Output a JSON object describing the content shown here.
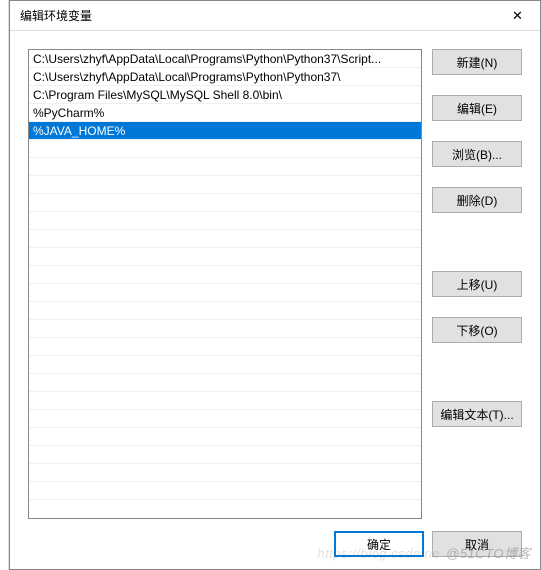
{
  "dialog": {
    "title": "编辑环境变量",
    "close_symbol": "✕"
  },
  "list": {
    "items": [
      "C:\\Users\\zhyf\\AppData\\Local\\Programs\\Python\\Python37\\Script...",
      "C:\\Users\\zhyf\\AppData\\Local\\Programs\\Python\\Python37\\",
      "C:\\Program Files\\MySQL\\MySQL Shell 8.0\\bin\\",
      "%PyCharm%",
      "%JAVA_HOME%"
    ],
    "selected_index": 4
  },
  "buttons": {
    "new": "新建(N)",
    "edit": "编辑(E)",
    "browse": "浏览(B)...",
    "delete": "删除(D)",
    "move_up": "上移(U)",
    "move_down": "下移(O)",
    "edit_text": "编辑文本(T)...",
    "ok": "确定",
    "cancel": "取消"
  },
  "watermark": {
    "part1": "https://blog.csdn.ne",
    "part2": "@51CTO博客"
  }
}
